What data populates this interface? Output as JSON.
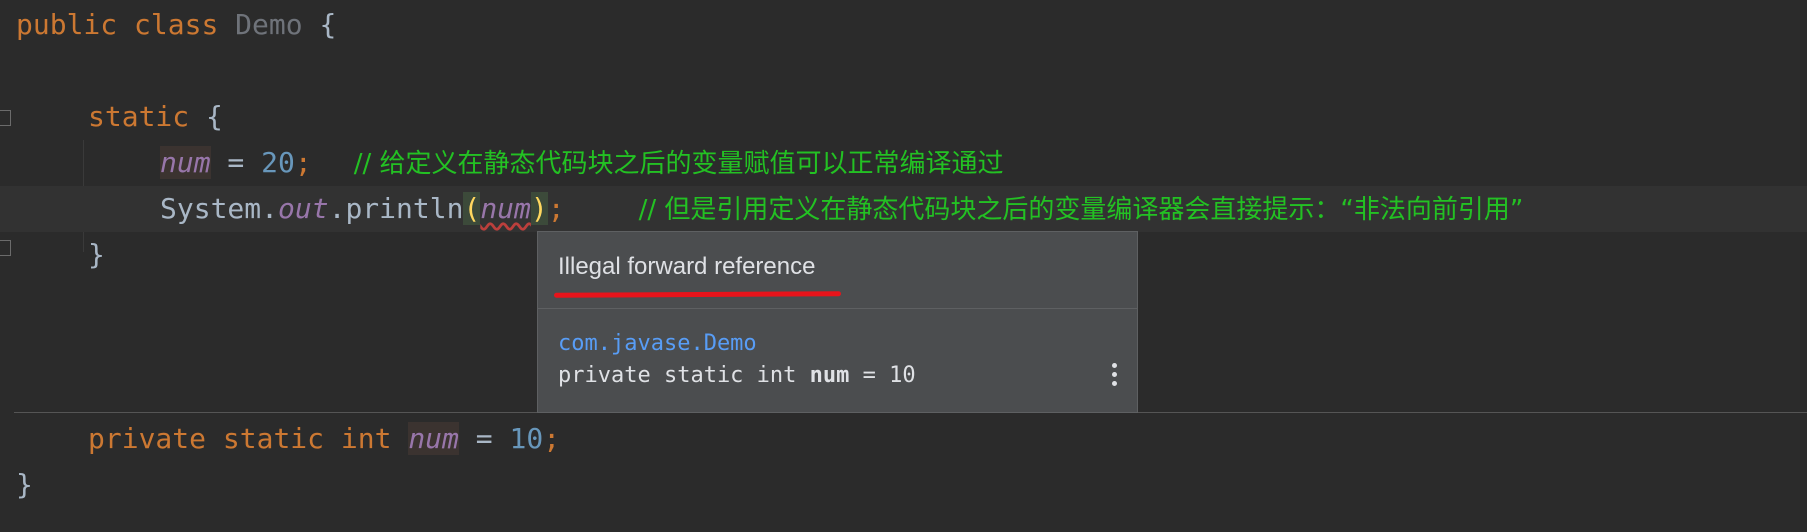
{
  "code": {
    "line1": {
      "kw_public": "public",
      "kw_class": "class",
      "class_name": "Demo",
      "brace": "{"
    },
    "line3": {
      "kw_static": "static",
      "brace": "{"
    },
    "line4": {
      "field": "num",
      "assign": " = ",
      "value": "20",
      "semi": ";",
      "comment": "// 给定义在静态代码块之后的变量赋值可以正常编译通过"
    },
    "line5": {
      "system": "System.",
      "out": "out",
      "println": ".println",
      "lparen": "(",
      "field": "num",
      "rparen": ")",
      "semi": ";",
      "comment": "// 但是引用定义在静态代码块之后的变量编译器会直接提示：“非法向前引用”"
    },
    "line6": {
      "brace": "}"
    },
    "line9": {
      "kw_private": "private",
      "kw_static": "static",
      "kw_int": "int",
      "field": "num",
      "assign": " = ",
      "value": "10",
      "semi": ";"
    },
    "line10": {
      "brace": "}"
    }
  },
  "popup": {
    "title": "Illegal forward reference",
    "package": "com.javase.Demo",
    "decl_prefix": "private static int ",
    "decl_name": "num",
    "decl_suffix": " = 10",
    "more_icon": "vertical-ellipsis-icon"
  },
  "colors": {
    "background": "#2b2b2b",
    "keyword": "#cc7832",
    "number": "#6897bb",
    "field": "#9876aa",
    "comment": "#23c123",
    "popup_bg": "#4b4d4f",
    "error_underline": "#e8141b"
  }
}
